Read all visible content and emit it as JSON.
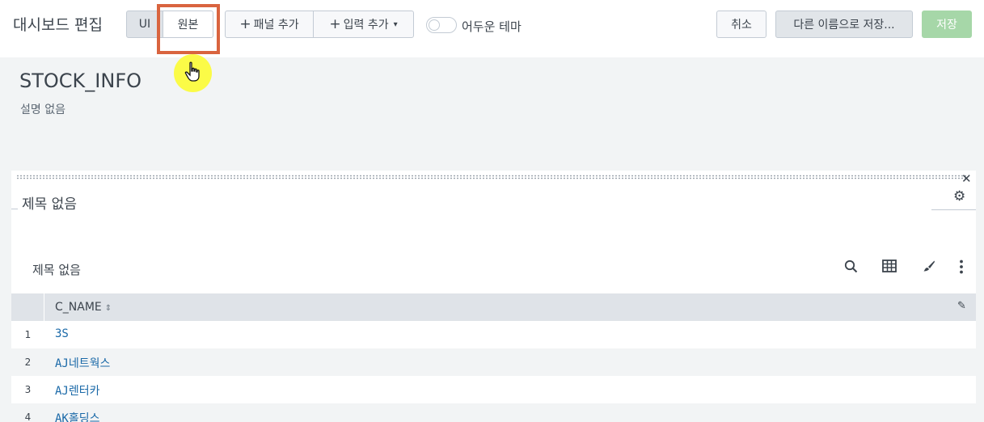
{
  "toolbar": {
    "title": "대시보드 편집",
    "seg_ui": "UI",
    "seg_source": "원본",
    "add_panel": "패널 추가",
    "add_input": "입력 추가",
    "plus": "+",
    "caret": "▾",
    "dark_theme_label": "어두운 테마",
    "dark_theme_on": false,
    "cancel": "취소",
    "save_as": "다른 이름으로 저장...",
    "save": "저장"
  },
  "dashboard": {
    "title": "STOCK_INFO",
    "description": "설명 없음"
  },
  "panel": {
    "title": "제목 없음",
    "close": "✕",
    "gear": "⚙",
    "viz_title": "제목 없음",
    "icons": {
      "search": "search-icon",
      "table": "table-icon",
      "format": "paintbrush-icon",
      "more": "more-icon"
    }
  },
  "table": {
    "column": "C_NAME",
    "sort_glyph": "⇕",
    "edit_glyph": "✎",
    "rows": [
      {
        "idx": "1",
        "value": "3S"
      },
      {
        "idx": "2",
        "value": "AJ네트웍스"
      },
      {
        "idx": "3",
        "value": "AJ렌터카"
      },
      {
        "idx": "4",
        "value": "AK홀딩스"
      }
    ]
  },
  "colors": {
    "highlight": "#d9643f",
    "cursor": "#fbfb3d",
    "link": "#1a69a8",
    "save_disabled": "#a6d7a8"
  }
}
